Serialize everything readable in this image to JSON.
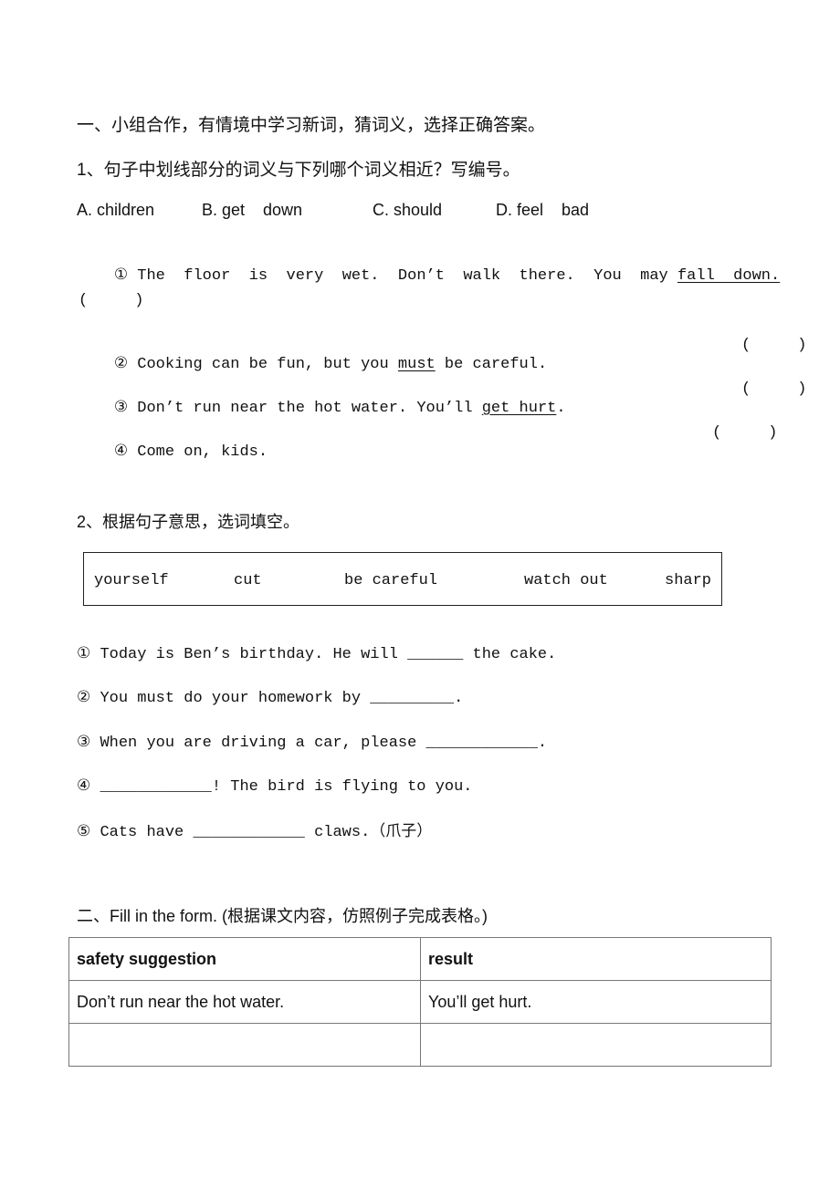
{
  "section1": {
    "title": "一、小组合作，有情境中学习新词，猜词义，选择正确答案。",
    "part1": {
      "instruction": "1、句子中划线部分的词义与下列哪个词义相近？写编号。",
      "options": [
        "A. children",
        "B. get    down",
        "C. should",
        "D. feel    bad"
      ],
      "items": [
        {
          "num": "①",
          "before": " The  floor  is  very  wet.  Don’t  walk  there.  You  may ",
          "underlined": "fall  down.",
          "after": " ",
          "answer_paren": "(     )"
        },
        {
          "num": "②",
          "before": " Cooking can be fun, but you ",
          "underlined": "must",
          "after": " be careful.",
          "answer_paren": "(     )"
        },
        {
          "num": "③",
          "before": " Don’t run near the hot water. You’ll ",
          "underlined": "get hurt",
          "after": ".",
          "answer_paren": "(     )"
        },
        {
          "num": "④",
          "before": " Come on, kids.",
          "underlined": "",
          "after": "",
          "answer_paren": "(     )"
        }
      ]
    },
    "part2": {
      "instruction": "2、根据句子意思，选词填空。",
      "word_bank": [
        "yourself",
        "cut",
        "be careful",
        "watch out",
        "sharp"
      ],
      "items": [
        "① Today is Ben’s birthday. He will ______ the cake.",
        "② You must do your homework by _________.",
        "③ When you are driving a car, please ____________.",
        "④ ____________! The bird is flying to you.",
        "⑤ Cats have ____________ claws.（爪子）"
      ]
    }
  },
  "section2": {
    "title": "二、Fill in the form. (根据课文内容，仿照例子完成表格。)",
    "table": {
      "headers": [
        "safety suggestion",
        "result"
      ],
      "rows": [
        [
          "Don’t run near the hot water.",
          "You’ll get hurt."
        ],
        [
          "",
          ""
        ]
      ]
    }
  }
}
